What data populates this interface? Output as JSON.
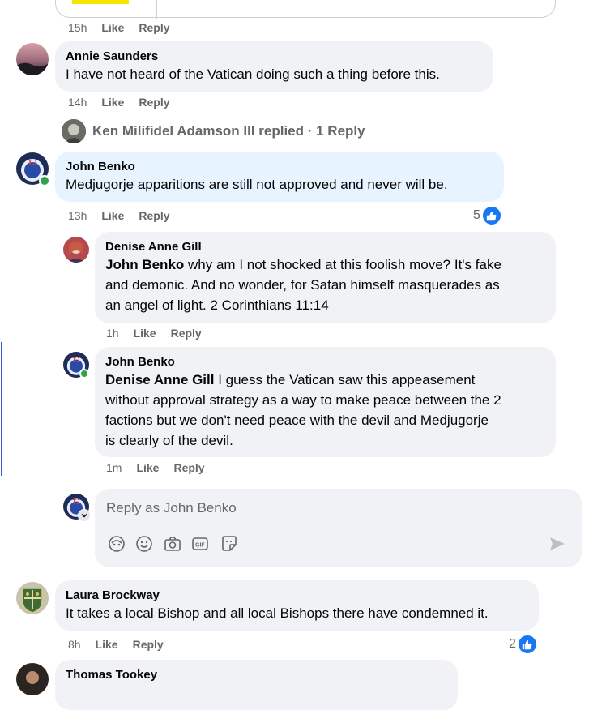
{
  "top_comment": {
    "time": "15h",
    "like": "Like",
    "reply": "Reply"
  },
  "comments": [
    {
      "author": "Annie Saunders",
      "text": "I have not heard of the Vatican doing such a thing before this.",
      "time": "14h",
      "like": "Like",
      "reply": "Reply"
    },
    {
      "author": "John Benko",
      "text": "Medjugorje apparitions are still not approved and never will be.",
      "time": "13h",
      "like": "Like",
      "reply": "Reply",
      "reactions": "5"
    },
    {
      "author": "Laura Brockway",
      "text": "It takes a local Bishop and all local Bishops there have condemned it.",
      "time": "8h",
      "like": "Like",
      "reply": "Reply",
      "reactions": "2"
    },
    {
      "author": "Thomas Tookey"
    }
  ],
  "replied_summary": {
    "text": "Ken Milifidel Adamson III replied · 1 Reply"
  },
  "replies": [
    {
      "author": "Denise Anne Gill",
      "mention": "John Benko",
      "text_lines": [
        " why am I not shocked at this foolish move? It's fake",
        "and demonic. And no wonder, for Satan himself masquerades as",
        "an angel of light. 2 Corinthians 11:14"
      ],
      "time": "1h",
      "like": "Like",
      "reply": "Reply"
    },
    {
      "author": "John Benko",
      "mention": "Denise Anne Gill",
      "text_lines": [
        " I guess the Vatican saw this appeasement",
        "without approval strategy as a way to make peace between the 2",
        "factions but we don't need peace with the devil and Medjugorje",
        "is clearly of the devil."
      ],
      "time": "1m",
      "like": "Like",
      "reply": "Reply"
    }
  ],
  "composer": {
    "placeholder": "Reply as John Benko",
    "tools": [
      "avatar-sticker-icon",
      "emoji-icon",
      "camera-icon",
      "gif-icon",
      "sticker-icon"
    ],
    "send_icon": "send-icon"
  },
  "colors": {
    "accent": "#1877f2",
    "bubble": "#f0f2f5",
    "highlight_bubble": "#e7f3ff",
    "meta": "#65676b",
    "online": "#31a24c"
  }
}
